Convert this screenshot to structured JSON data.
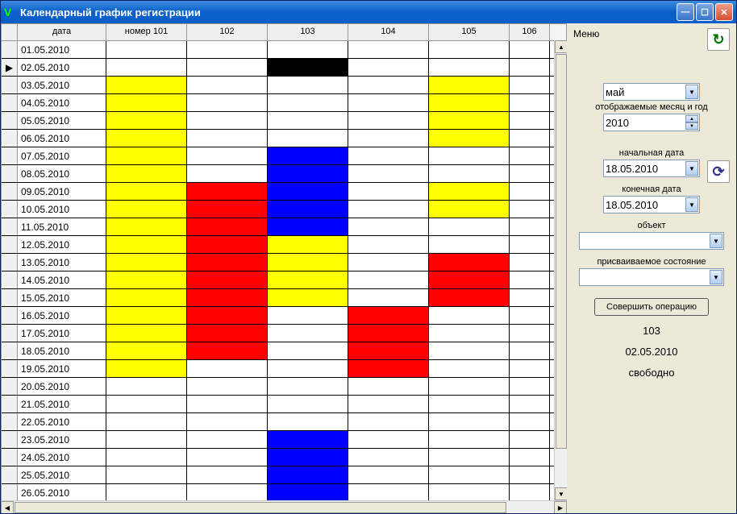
{
  "titlebar": {
    "title": "Календарный график регистрации"
  },
  "grid": {
    "headers": {
      "date": "дата",
      "room1": "номер 101",
      "room2": "102",
      "room3": "103",
      "room4": "104",
      "room5": "105",
      "room6": "106"
    },
    "rows": [
      {
        "date": "01.05.2010",
        "arrow": false,
        "cells": [
          "white",
          "white",
          "white",
          "white",
          "white",
          "white"
        ]
      },
      {
        "date": "02.05.2010",
        "arrow": true,
        "cells": [
          "white",
          "white",
          "black",
          "white",
          "white",
          "white"
        ]
      },
      {
        "date": "03.05.2010",
        "arrow": false,
        "cells": [
          "yellow",
          "white",
          "white",
          "white",
          "yellow",
          "white"
        ]
      },
      {
        "date": "04.05.2010",
        "arrow": false,
        "cells": [
          "yellow",
          "white",
          "white",
          "white",
          "yellow",
          "white"
        ]
      },
      {
        "date": "05.05.2010",
        "arrow": false,
        "cells": [
          "yellow",
          "white",
          "white",
          "white",
          "yellow",
          "white"
        ]
      },
      {
        "date": "06.05.2010",
        "arrow": false,
        "cells": [
          "yellow",
          "white",
          "white",
          "white",
          "yellow",
          "white"
        ]
      },
      {
        "date": "07.05.2010",
        "arrow": false,
        "cells": [
          "yellow",
          "white",
          "blue",
          "white",
          "white",
          "white"
        ]
      },
      {
        "date": "08.05.2010",
        "arrow": false,
        "cells": [
          "yellow",
          "white",
          "blue",
          "white",
          "white",
          "white"
        ]
      },
      {
        "date": "09.05.2010",
        "arrow": false,
        "cells": [
          "yellow",
          "red",
          "blue",
          "white",
          "yellow",
          "white"
        ]
      },
      {
        "date": "10.05.2010",
        "arrow": false,
        "cells": [
          "yellow",
          "red",
          "blue",
          "white",
          "yellow",
          "white"
        ]
      },
      {
        "date": "11.05.2010",
        "arrow": false,
        "cells": [
          "yellow",
          "red",
          "blue",
          "white",
          "white",
          "white"
        ]
      },
      {
        "date": "12.05.2010",
        "arrow": false,
        "cells": [
          "yellow",
          "red",
          "yellow",
          "white",
          "white",
          "white"
        ]
      },
      {
        "date": "13.05.2010",
        "arrow": false,
        "cells": [
          "yellow",
          "red",
          "yellow",
          "white",
          "red",
          "white"
        ]
      },
      {
        "date": "14.05.2010",
        "arrow": false,
        "cells": [
          "yellow",
          "red",
          "yellow",
          "white",
          "red",
          "white"
        ]
      },
      {
        "date": "15.05.2010",
        "arrow": false,
        "cells": [
          "yellow",
          "red",
          "yellow",
          "white",
          "red",
          "white"
        ]
      },
      {
        "date": "16.05.2010",
        "arrow": false,
        "cells": [
          "yellow",
          "red",
          "white",
          "red",
          "white",
          "white"
        ]
      },
      {
        "date": "17.05.2010",
        "arrow": false,
        "cells": [
          "yellow",
          "red",
          "white",
          "red",
          "white",
          "white"
        ]
      },
      {
        "date": "18.05.2010",
        "arrow": false,
        "cells": [
          "yellow",
          "red",
          "white",
          "red",
          "white",
          "white"
        ]
      },
      {
        "date": "19.05.2010",
        "arrow": false,
        "cells": [
          "yellow",
          "white",
          "white",
          "red",
          "white",
          "white"
        ]
      },
      {
        "date": "20.05.2010",
        "arrow": false,
        "cells": [
          "white",
          "white",
          "white",
          "white",
          "white",
          "white"
        ]
      },
      {
        "date": "21.05.2010",
        "arrow": false,
        "cells": [
          "white",
          "white",
          "white",
          "white",
          "white",
          "white"
        ]
      },
      {
        "date": "22.05.2010",
        "arrow": false,
        "cells": [
          "white",
          "white",
          "white",
          "white",
          "white",
          "white"
        ]
      },
      {
        "date": "23.05.2010",
        "arrow": false,
        "cells": [
          "white",
          "white",
          "blue",
          "white",
          "white",
          "white"
        ]
      },
      {
        "date": "24.05.2010",
        "arrow": false,
        "cells": [
          "white",
          "white",
          "blue",
          "white",
          "white",
          "white"
        ]
      },
      {
        "date": "25.05.2010",
        "arrow": false,
        "cells": [
          "white",
          "white",
          "blue",
          "white",
          "white",
          "white"
        ]
      },
      {
        "date": "26.05.2010",
        "arrow": false,
        "cells": [
          "white",
          "white",
          "blue",
          "white",
          "white",
          "white"
        ]
      }
    ]
  },
  "sidebar": {
    "menu": "Меню",
    "month_value": "май",
    "month_label": "отображаемые месяц и год",
    "year_value": "2010",
    "start_label": "начальная дата",
    "start_value": "18.05.2010",
    "end_label": "конечная дата",
    "end_value": "18.05.2010",
    "object_label": "объект",
    "object_value": "",
    "state_label": "присваиваемое состояние",
    "state_value": "",
    "action": "Совершить операцию",
    "status_room": "103",
    "status_date": "02.05.2010",
    "status_state": "свободно"
  }
}
